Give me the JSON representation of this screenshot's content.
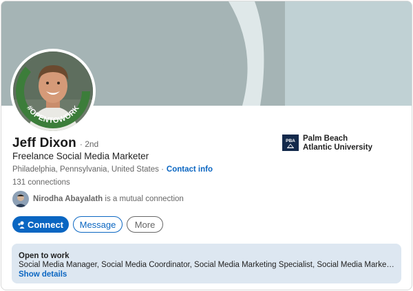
{
  "profile": {
    "name": "Jeff Dixon",
    "degree": "· 2nd",
    "headline": "Freelance Social Media Marketer",
    "location": "Philadelphia, Pennsylvania, United States ·",
    "contact_info": "Contact info",
    "connections": "131 connections",
    "badge_text": "#OPENTOWORK"
  },
  "mutual": {
    "name": "Nirodha Abayalath",
    "suffix": "is a mutual connection"
  },
  "actions": {
    "connect": "Connect",
    "message": "Message",
    "more": "More"
  },
  "school": {
    "name": "Palm Beach Atlantic University",
    "logo_text": "PBA"
  },
  "open_to_work": {
    "title": "Open to work",
    "roles": "Social Media Manager, Social Media Coordinator, Social Media Marketing Specialist, Social Media Marketing Manage...",
    "link": "Show details"
  },
  "colors": {
    "accent": "#0a66c2",
    "banner_dark": "#a5b4b5",
    "banner_light": "#c0d1d4",
    "open_to_work_green": "#3c7d3a",
    "school_navy": "#13294b"
  },
  "icons": {
    "connect": "add-person-icon",
    "school": "school-logo-icon"
  }
}
